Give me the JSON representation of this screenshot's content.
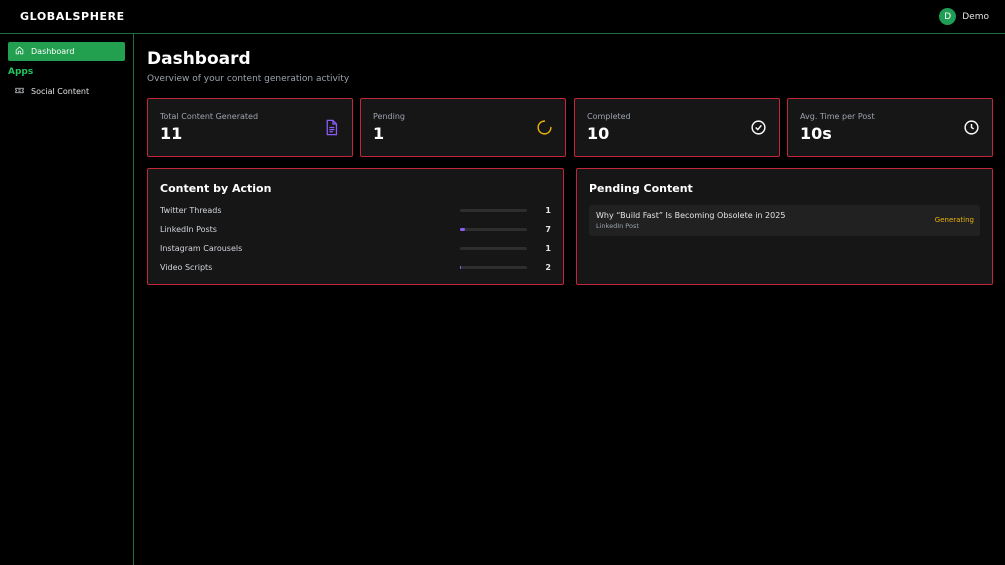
{
  "header": {
    "logo": "GLOBALSPHERE",
    "avatar_initial": "D",
    "user_name": "Demo"
  },
  "sidebar": {
    "items": [
      {
        "label": "Dashboard",
        "icon": "home-icon",
        "active": true
      },
      {
        "label": "Social Content",
        "icon": "ticket-icon",
        "active": false
      }
    ],
    "section_label": "Apps"
  },
  "page": {
    "title": "Dashboard",
    "subtitle": "Overview of your content generation activity"
  },
  "stats": [
    {
      "label": "Total Content Generated",
      "value": "11",
      "icon": "document-icon"
    },
    {
      "label": "Pending",
      "value": "1",
      "icon": "spinner-icon"
    },
    {
      "label": "Completed",
      "value": "10",
      "icon": "check-circle-icon"
    },
    {
      "label": "Avg. Time per Post",
      "value": "10s",
      "icon": "clock-icon"
    }
  ],
  "content_by_action": {
    "title": "Content by Action",
    "rows": [
      {
        "label": "Twitter Threads",
        "count": "1",
        "progress": 0
      },
      {
        "label": "LinkedIn Posts",
        "count": "7",
        "progress": 0.08
      },
      {
        "label": "Instagram Carousels",
        "count": "1",
        "progress": 0
      },
      {
        "label": "Video Scripts",
        "count": "2",
        "progress": 0.02
      }
    ]
  },
  "pending_content": {
    "title": "Pending Content",
    "items": [
      {
        "title": "Why “Build Fast” Is Becoming Obsolete in 2025",
        "type": "LinkedIn Post",
        "status": "Generating"
      }
    ]
  },
  "colors": {
    "accent_green": "#22a04f",
    "card_border": "#c2263a",
    "progress": "#8b5cf6",
    "status_generating": "#eab308",
    "icon_purple": "#8b5cf6",
    "icon_yellow": "#eab308"
  }
}
